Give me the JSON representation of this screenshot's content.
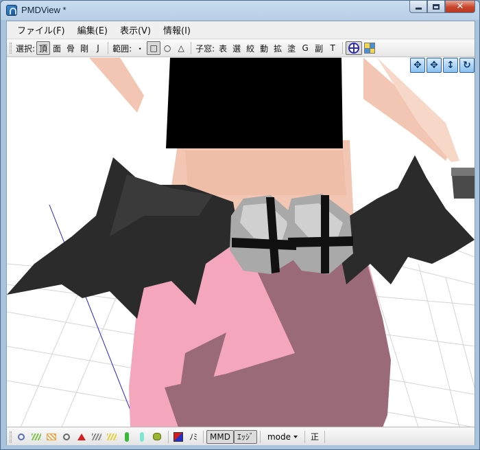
{
  "window": {
    "title": "PMDView *",
    "close_glyph": "✕"
  },
  "menu": [
    {
      "label": "ファイル(F)"
    },
    {
      "label": "編集(E)"
    },
    {
      "label": "表示(V)"
    },
    {
      "label": "情報(I)"
    }
  ],
  "toolbar": {
    "select_label": "選択:",
    "select_modes": [
      "頂",
      "面",
      "骨",
      "剛",
      "J"
    ],
    "select_active": "頂",
    "range_label": "範囲:",
    "range_modes": [
      "・",
      "□",
      "○",
      "△"
    ],
    "range_active": "□",
    "child_label": "子窓:",
    "child_windows": [
      "表",
      "選",
      "絞",
      "動",
      "拡",
      "塗",
      "G",
      "副",
      "T"
    ]
  },
  "nav_tools": [
    {
      "name": "move-xy-icon",
      "glyph": "✥"
    },
    {
      "name": "move-xz-icon",
      "glyph": "✥"
    },
    {
      "name": "zoom-icon",
      "glyph": "↕"
    },
    {
      "name": "rotate-icon",
      "glyph": "↻"
    }
  ],
  "statusbar": {
    "nomi_label": "ﾉﾐ",
    "mmd_label": "MMD",
    "edge_label": "ｴｯｼﾞ",
    "mode_label": "mode",
    "sei_label": "正"
  },
  "colors": {
    "skirt": "#f4a6bd",
    "skirt_shadow": "#9b6a78",
    "skin": "#f2c6b2",
    "wing": "#2b2b2b",
    "top": "#000000",
    "bell": "#b9b9b9"
  }
}
